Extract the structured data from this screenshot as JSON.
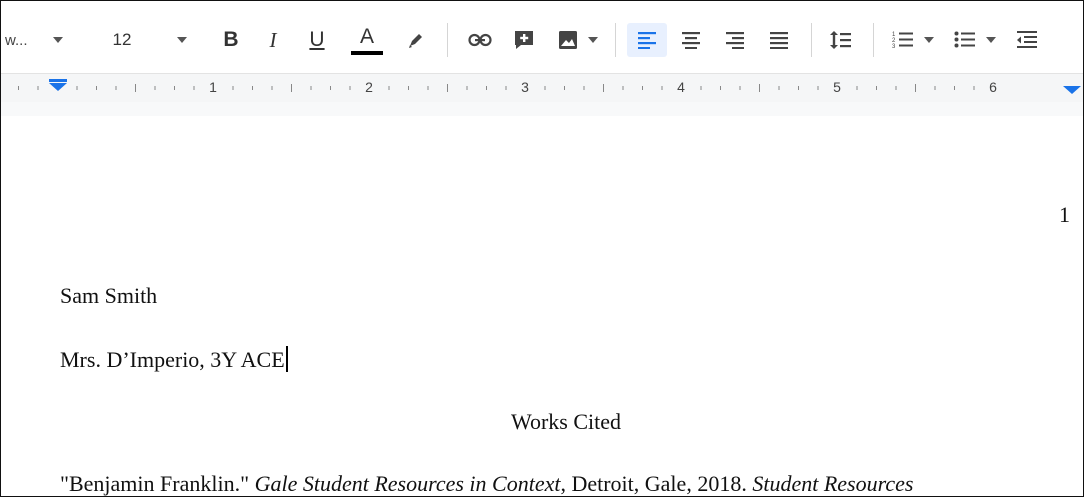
{
  "toolbar": {
    "font_name": "w...",
    "font_size": "12",
    "buttons": {
      "bold": "B",
      "italic": "I",
      "underline": "U",
      "text_color": "A"
    },
    "text_color_swatch": "#000000",
    "icons": [
      "font-dropdown-arrow-icon",
      "size-dropdown-arrow-icon",
      "highlight-pen-icon",
      "link-icon",
      "add-comment-icon",
      "insert-image-icon",
      "align-left-icon",
      "align-center-icon",
      "align-right-icon",
      "justify-icon",
      "line-spacing-icon",
      "numbered-list-icon",
      "bulleted-list-icon",
      "decrease-indent-icon"
    ],
    "accent_color": "#1a73e8"
  },
  "ruler": {
    "numbers": [
      "1",
      "2",
      "3",
      "4",
      "5",
      "6"
    ],
    "marker_color": "#1a73e8"
  },
  "document": {
    "page_number": "1",
    "line1": "Sam Smith",
    "line2": "Mrs. D’Imperio, 3Y ACE",
    "title": "Works Cited",
    "citation": {
      "part1": "\"Benjamin Franklin.\" ",
      "part2_italic": "Gale Student Resources in Context",
      "part3": ", Detroit, Gale, 2018. ",
      "part4_italic": "Student Resources"
    }
  }
}
